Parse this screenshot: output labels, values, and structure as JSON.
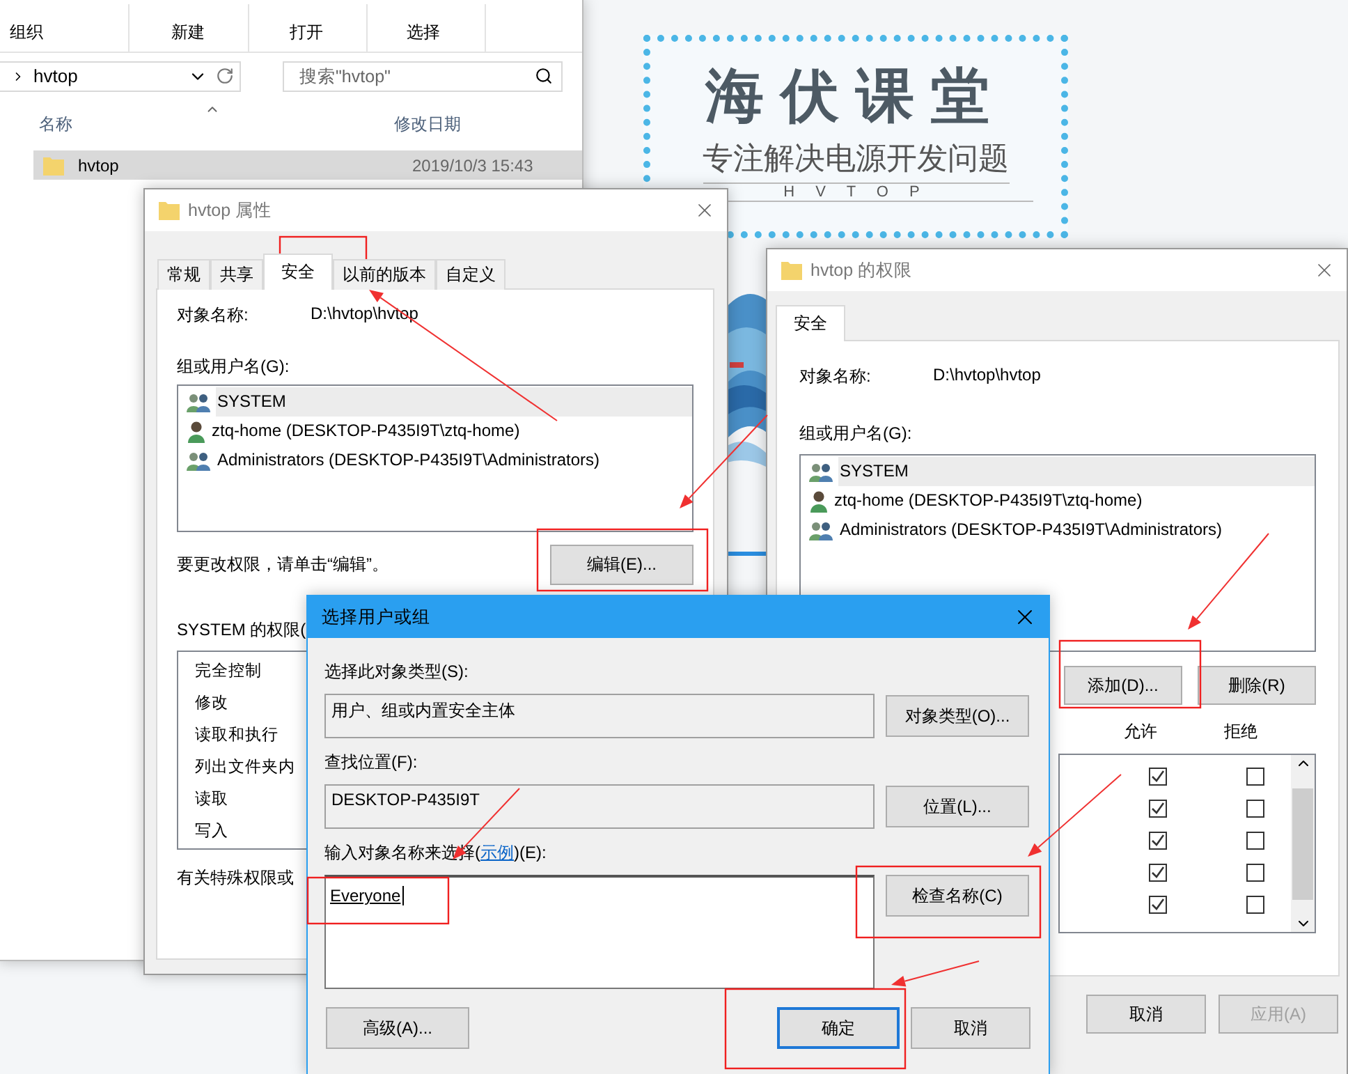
{
  "explorer": {
    "ribbon_groups": [
      "组织",
      "新建",
      "打开",
      "选择"
    ],
    "address": "hvtop",
    "search": {
      "placeholder": "搜索\"hvtop\""
    },
    "columns": [
      "名称",
      "修改日期"
    ],
    "rows": [
      {
        "name": "hvtop",
        "modified": "2019/10/3 15:43",
        "selected": true
      }
    ]
  },
  "banner": {
    "title": "海伏课堂",
    "subtitle": "专注解决电源开发问题",
    "brand": "H V T O P"
  },
  "properties": {
    "title": "hvtop 属性",
    "tabs": [
      {
        "label": "常规",
        "selected": false
      },
      {
        "label": "共享",
        "selected": false
      },
      {
        "label": "安全",
        "selected": true
      },
      {
        "label": "以前的版本",
        "selected": false
      },
      {
        "label": "自定义",
        "selected": false
      }
    ],
    "object_label": "对象名称:",
    "object_value": "D:\\hvtop\\hvtop",
    "group_label": "组或用户名(G):",
    "users": [
      {
        "name": "SYSTEM",
        "kind": "group",
        "selected": true
      },
      {
        "name": "ztq-home (DESKTOP-P435I9T\\ztq-home)",
        "kind": "user",
        "selected": false
      },
      {
        "name": "Administrators (DESKTOP-P435I9T\\Administrators)",
        "kind": "group",
        "selected": false
      }
    ],
    "hint": "要更改权限，请单击“编辑”。",
    "edit_button": "编辑(E)...",
    "permissions_label": "SYSTEM 的权限(",
    "permissions": [
      "完全控制",
      "修改",
      "读取和执行",
      "列出文件夹内",
      "读取",
      "写入"
    ],
    "footer": "有关特殊权限或"
  },
  "permissions_window": {
    "title": "hvtop 的权限",
    "tab": "安全",
    "object_label": "对象名称:",
    "object_value": "D:\\hvtop\\hvtop",
    "group_label": "组或用户名(G):",
    "users": [
      {
        "name": "SYSTEM",
        "kind": "group",
        "selected": true
      },
      {
        "name": "ztq-home (DESKTOP-P435I9T\\ztq-home)",
        "kind": "user",
        "selected": false
      },
      {
        "name": "Administrators (DESKTOP-P435I9T\\Administrators)",
        "kind": "group",
        "selected": false
      }
    ],
    "add_button": "添加(D)...",
    "remove_button": "删除(R)",
    "allow_header": "允许",
    "deny_header": "拒绝",
    "rows": [
      {
        "allow": true,
        "deny": false
      },
      {
        "allow": true,
        "deny": false
      },
      {
        "allow": true,
        "deny": false
      },
      {
        "allow": true,
        "deny": false
      },
      {
        "allow": true,
        "deny": false
      }
    ],
    "buttons": [
      {
        "label": "取消",
        "disabled": false
      },
      {
        "label": "应用(A)",
        "disabled": true
      }
    ]
  },
  "dialog": {
    "title": "选择用户或组",
    "type_label": "选择此对象类型(S):",
    "type_value": "用户、组或内置安全主体",
    "type_button": "对象类型(O)...",
    "location_label": "查找位置(F):",
    "location_value": "DESKTOP-P435I9T",
    "location_button": "位置(L)...",
    "names_label_before": "输入对象名称来选择(",
    "names_link": "示例",
    "names_label_after": ")(E):",
    "names_value": "Everyone",
    "check_button": "检查名称(C)",
    "advanced_button": "高级(A)...",
    "ok_button": "确定",
    "cancel_button": "取消"
  }
}
